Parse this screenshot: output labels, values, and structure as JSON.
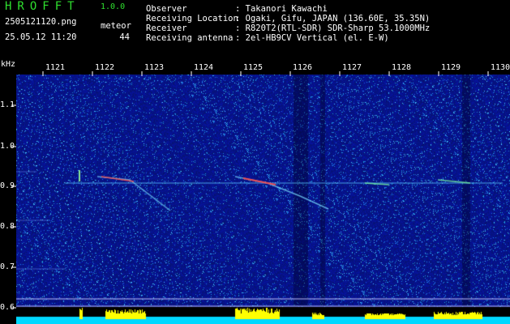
{
  "header": {
    "app_title": "HROFFT",
    "app_version": "1.0.0",
    "filename": "2505121120.png",
    "datetime": "25.05.12 11:20",
    "meteor_label": "meteor",
    "meteor_count": "44",
    "info": [
      {
        "key": "Observer",
        "value": ": Takanori Kawachi"
      },
      {
        "key": "Receiving Location",
        "value": ": Ogaki, Gifu, JAPAN (136.60E, 35.35N)"
      },
      {
        "key": "Receiver",
        "value": ": R820T2(RTL-SDR) SDR-Sharp 53.1000MHz"
      },
      {
        "key": "Receiving antenna",
        "value": ": 2el-HB9CV Vertical (el. E-W)"
      }
    ]
  },
  "axes": {
    "y_unit": "kHz",
    "y_ticks": [
      "1.1",
      "1.0",
      "0.9",
      "0.8",
      "0.7",
      "0.6"
    ],
    "x_ticks": [
      "1121",
      "1122",
      "1123",
      "1124",
      "1125",
      "1126",
      "1127",
      "1128",
      "1129",
      "1130"
    ]
  },
  "colors": {
    "title": "#2fe02f",
    "background_noise": "#0a1a8c",
    "signal": "#ff4040",
    "bottom_bar": "#00d8ff",
    "bottom_peaks": "#ffff00",
    "carrier": "#40c0ff"
  }
}
